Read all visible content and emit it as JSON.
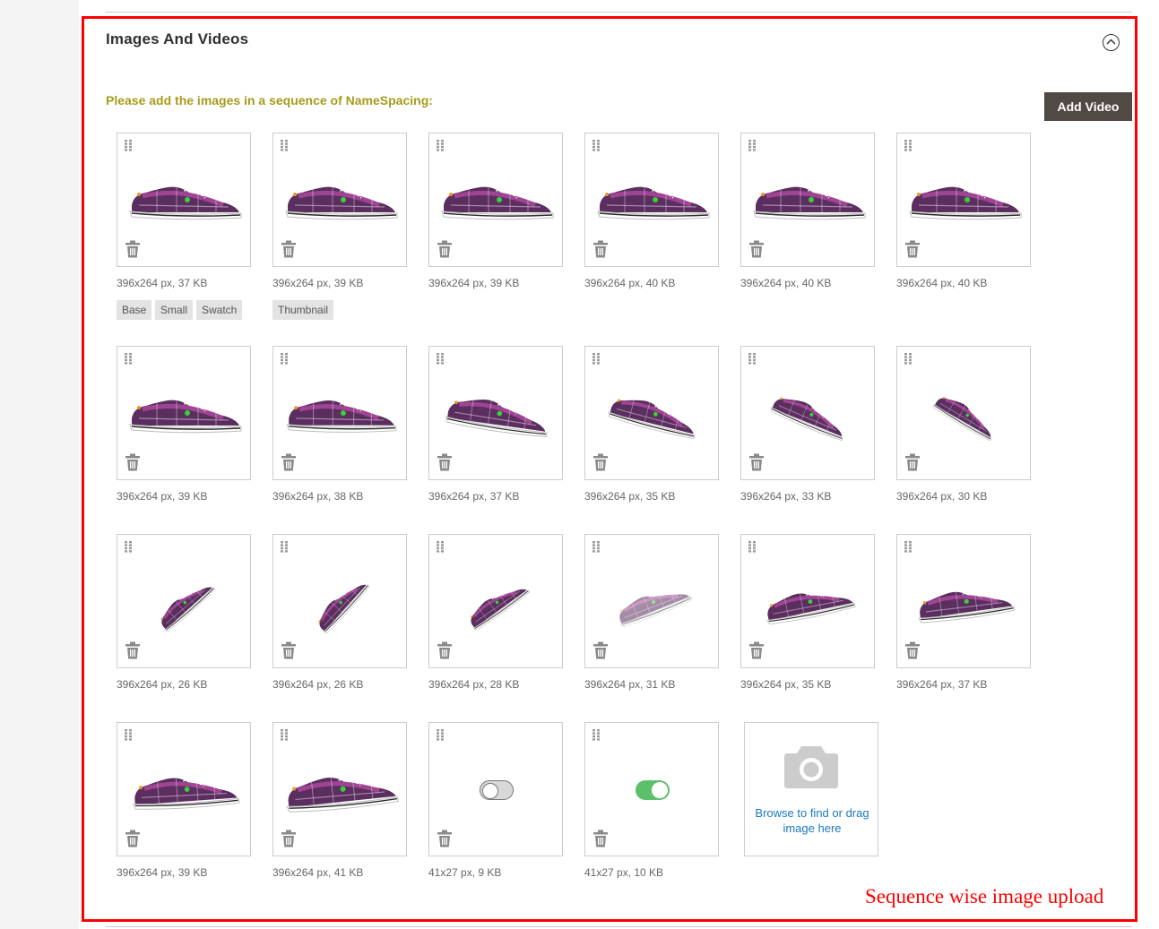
{
  "section": {
    "title": "Images And Videos",
    "collapse_icon": "chevron-up-circle-icon"
  },
  "notice": "Please add the images in a sequence of NameSpacing:",
  "add_video_label": "Add Video",
  "colors": {
    "frame": "#ff0000",
    "notice": "#a69b1b",
    "button": "#514943",
    "link": "#1979c3",
    "toggle_on": "#5cc06a",
    "toggle_off": "#d8d8d8",
    "shoe_body": "#5a2e5e",
    "shoe_plaid": "#b04aa0"
  },
  "images": [
    {
      "meta": "396x264 px, 37 KB",
      "roles": [
        "Base",
        "Small",
        "Swatch"
      ]
    },
    {
      "meta": "396x264 px, 39 KB",
      "roles": [
        "Thumbnail"
      ]
    },
    {
      "meta": "396x264 px, 39 KB",
      "roles": []
    },
    {
      "meta": "396x264 px, 40 KB",
      "roles": []
    },
    {
      "meta": "396x264 px, 40 KB",
      "roles": []
    },
    {
      "meta": "396x264 px, 40 KB",
      "roles": []
    },
    {
      "meta": "396x264 px, 39 KB",
      "roles": []
    },
    {
      "meta": "396x264 px, 38 KB",
      "roles": []
    },
    {
      "meta": "396x264 px, 37 KB",
      "roles": []
    },
    {
      "meta": "396x264 px, 35 KB",
      "roles": []
    },
    {
      "meta": "396x264 px, 33 KB",
      "roles": []
    },
    {
      "meta": "396x264 px, 30 KB",
      "roles": []
    },
    {
      "meta": "396x264 px, 26 KB",
      "roles": []
    },
    {
      "meta": "396x264 px, 26 KB",
      "roles": []
    },
    {
      "meta": "396x264 px, 28 KB",
      "roles": []
    },
    {
      "meta": "396x264 px, 31 KB",
      "roles": []
    },
    {
      "meta": "396x264 px, 35 KB",
      "roles": []
    },
    {
      "meta": "396x264 px, 37 KB",
      "roles": []
    },
    {
      "meta": "396x264 px, 39 KB",
      "roles": []
    },
    {
      "meta": "396x264 px, 41 KB",
      "roles": []
    },
    {
      "meta": "41x27 px, 9 KB",
      "roles": [],
      "toggle": "off"
    },
    {
      "meta": "41x27 px, 10 KB",
      "roles": [],
      "toggle": "on"
    }
  ],
  "uploader": {
    "icon": "camera-icon",
    "hint": "Browse to find or drag image here"
  },
  "caption": "Sequence wise image upload"
}
